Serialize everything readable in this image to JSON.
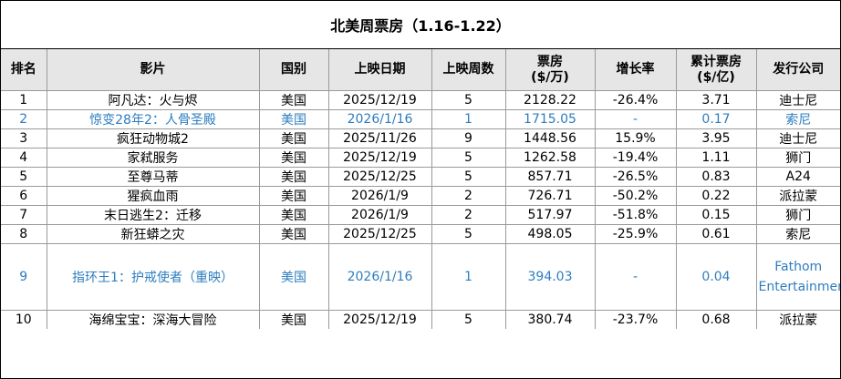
{
  "title": "北美周票房（1.16-1.22）",
  "columns": [
    "排名",
    "影片",
    "国别",
    "上映日期",
    "上映周数",
    "票房\n($/万)",
    "增长率",
    "累计票房\n($/亿)",
    "发行公司"
  ],
  "rows": [
    {
      "rank": "1",
      "film": "阿凡达：火与烬",
      "country": "美国",
      "release": "2025/12/19",
      "weeks": "5",
      "gross": "2128.22",
      "growth": "-26.4%",
      "total": "3.71",
      "distributor": "迪士尼",
      "highlight": false
    },
    {
      "rank": "2",
      "film": "惊变28年2：人骨圣殿",
      "country": "美国",
      "release": "2026/1/16",
      "weeks": "1",
      "gross": "1715.05",
      "growth": "-",
      "total": "0.17",
      "distributor": "索尼",
      "highlight": true
    },
    {
      "rank": "3",
      "film": "疯狂动物城2",
      "country": "美国",
      "release": "2025/11/26",
      "weeks": "9",
      "gross": "1448.56",
      "growth": "15.9%",
      "total": "3.95",
      "distributor": "迪士尼",
      "highlight": false
    },
    {
      "rank": "4",
      "film": "家弒服务",
      "country": "美国",
      "release": "2025/12/19",
      "weeks": "5",
      "gross": "1262.58",
      "growth": "-19.4%",
      "total": "1.11",
      "distributor": "狮门",
      "highlight": false
    },
    {
      "rank": "5",
      "film": "至尊马蒂",
      "country": "美国",
      "release": "2025/12/25",
      "weeks": "5",
      "gross": "857.71",
      "growth": "-26.5%",
      "total": "0.83",
      "distributor": "A24",
      "highlight": false
    },
    {
      "rank": "6",
      "film": "猩疯血雨",
      "country": "美国",
      "release": "2026/1/9",
      "weeks": "2",
      "gross": "726.71",
      "growth": "-50.2%",
      "total": "0.22",
      "distributor": "派拉蒙",
      "highlight": false
    },
    {
      "rank": "7",
      "film": "末日逃生2：迁移",
      "country": "美国",
      "release": "2026/1/9",
      "weeks": "2",
      "gross": "517.97",
      "growth": "-51.8%",
      "total": "0.15",
      "distributor": "狮门",
      "highlight": false
    },
    {
      "rank": "8",
      "film": "新狂蟒之灾",
      "country": "美国",
      "release": "2025/12/25",
      "weeks": "5",
      "gross": "498.05",
      "growth": "-25.9%",
      "total": "0.61",
      "distributor": "索尼",
      "highlight": false
    },
    {
      "rank": "9",
      "film": "指环王1：护戒使者（重映）",
      "country": "美国",
      "release": "2026/1/16",
      "weeks": "1",
      "gross": "394.03",
      "growth": "-",
      "total": "0.04",
      "distributor": "Fathom Entertainment",
      "highlight": true
    },
    {
      "rank": "10",
      "film": "海绵宝宝：深海大冒险",
      "country": "美国",
      "release": "2025/12/19",
      "weeks": "5",
      "gross": "380.74",
      "growth": "-23.7%",
      "total": "0.68",
      "distributor": "派拉蒙",
      "highlight": false
    }
  ]
}
